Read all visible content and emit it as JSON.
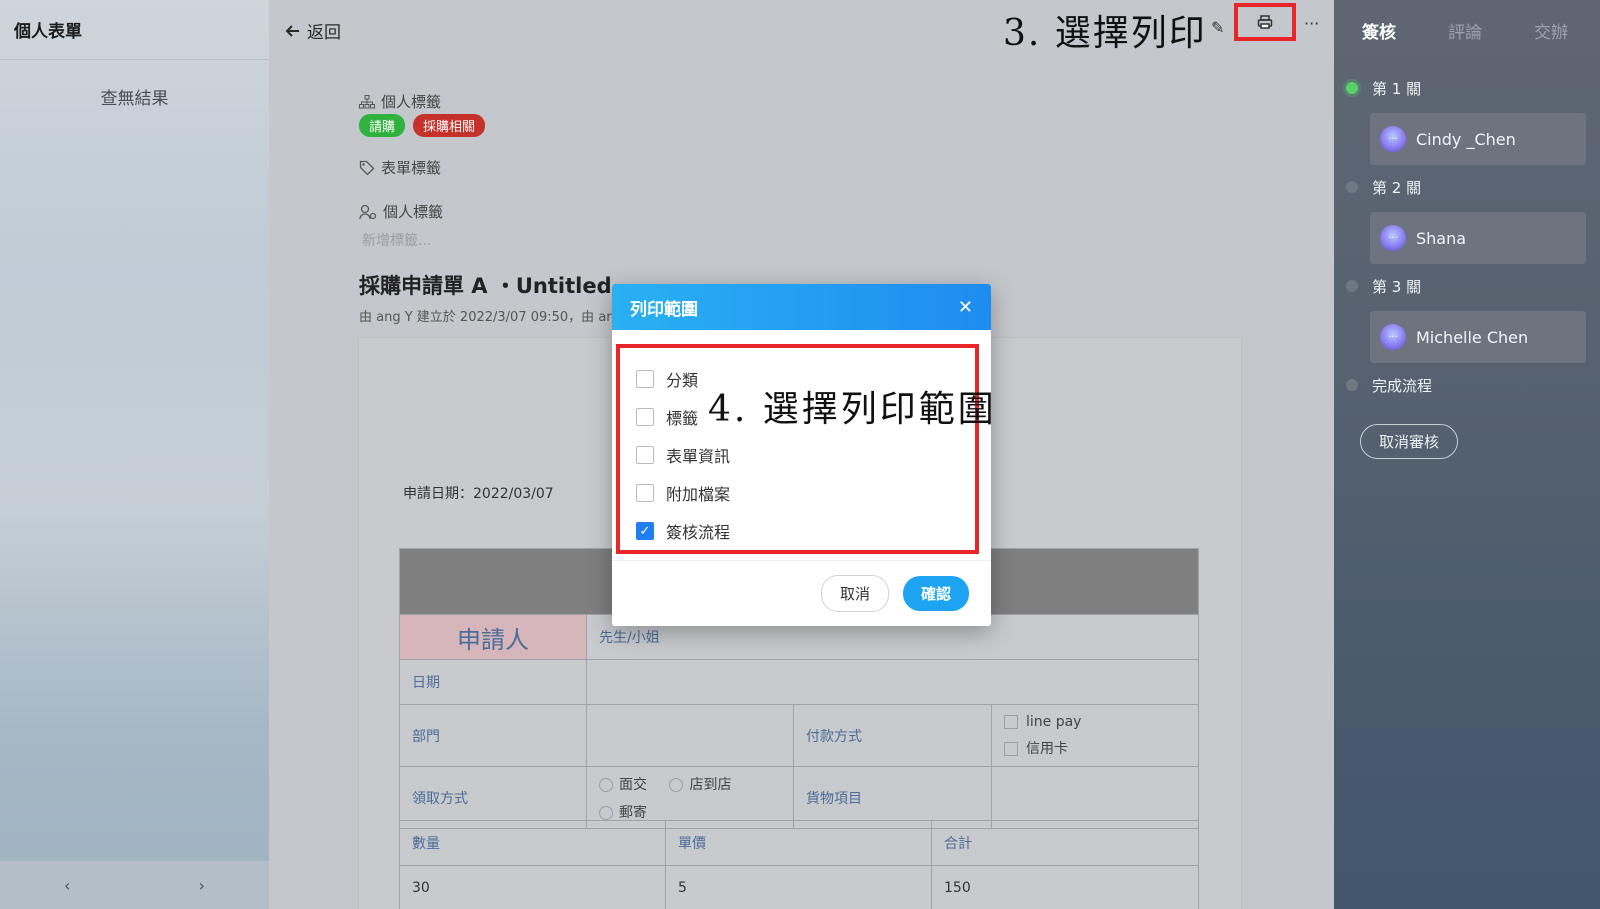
{
  "left": {
    "title": "個人表單",
    "empty": "查無結果",
    "prev": "‹",
    "next": "›"
  },
  "toolbar": {
    "back_label": "返回",
    "annotation_step3": "3. 選擇列印",
    "more": "···"
  },
  "meta": {
    "personal_tags_label": "個人標籤",
    "tags": [
      {
        "label": "請購",
        "color": "#2fb33e"
      },
      {
        "label": "採購相關",
        "color": "#c7312c"
      }
    ],
    "form_tags_label": "表單標籤",
    "personal_tags_label2": "個人標籤",
    "add_tag_placeholder": "新增標籤...",
    "form_title": "採購申請單 A ・Untitled",
    "created_by": "由 ang Y 建立於 2022/3/07 09:50，由 ar"
  },
  "paper": {
    "apply_date": "申請日期：2022/03/07",
    "applicant": "申請人",
    "mr_ms": "先生/小姐",
    "date": "日期",
    "dept": "部門",
    "payment": "付款方式",
    "pay_options": [
      "line pay",
      "信用卡"
    ],
    "pickup": "領取方式",
    "pickup_options": [
      "面交",
      "店到店",
      "郵寄"
    ],
    "goods": "貨物項目",
    "qty": "數量",
    "unit_price": "單價",
    "total": "合計",
    "qty_val": "30",
    "unit_price_val": "5",
    "total_val": "150"
  },
  "right": {
    "tabs": [
      "簽核",
      "評論",
      "交辦"
    ],
    "steps": [
      {
        "label": "第 1 關",
        "person": "Cindy _Chen"
      },
      {
        "label": "第 2 關",
        "person": "Shana"
      },
      {
        "label": "第 3 關",
        "person": "Michelle Chen"
      }
    ],
    "done": "完成流程",
    "cancel_review": "取消審核"
  },
  "modal": {
    "title": "列印範圍",
    "close": "✕",
    "options": [
      {
        "label": "分類",
        "checked": false
      },
      {
        "label": "標籤",
        "checked": false
      },
      {
        "label": "表單資訊",
        "checked": false
      },
      {
        "label": "附加檔案",
        "checked": false
      },
      {
        "label": "簽核流程",
        "checked": true
      }
    ],
    "annotation_step4": "4. 選擇列印範圍",
    "cancel": "取消",
    "confirm": "確認"
  }
}
